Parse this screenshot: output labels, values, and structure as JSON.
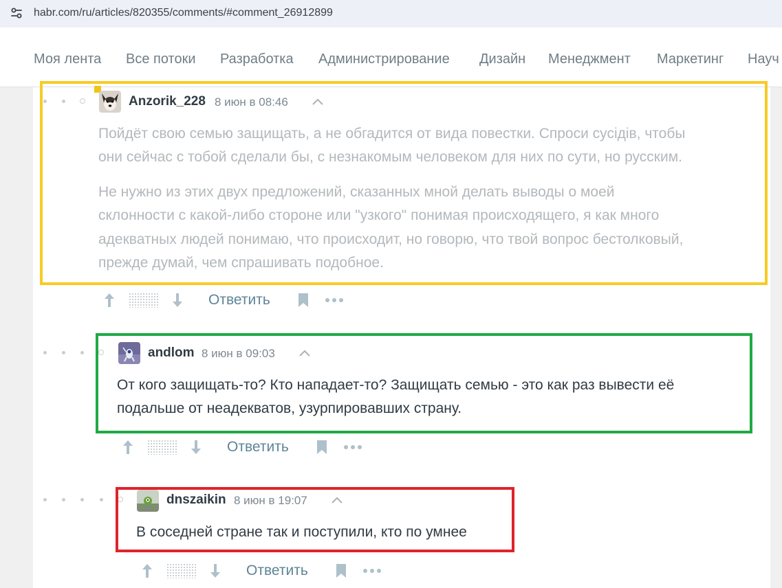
{
  "browser": {
    "url": "habr.com/ru/articles/820355/comments/#comment_26912899"
  },
  "nav": {
    "items": [
      "Моя лента",
      "Все потоки",
      "Разработка",
      "Администрирование",
      "Дизайн",
      "Менеджмент",
      "Маркетинг",
      "Науч"
    ]
  },
  "comments": [
    {
      "author": "Anzorik_228",
      "time": "8 июн в 08:46",
      "lines": [
        "Пойдёт свою семью защищать, а не обгадится от вида повестки. Спроси сусідів, чтобы",
        "они сейчас с тобой сделали бы, с незнакомым человеком для них по сути, но русским.",
        "Не нужно из этих двух предложений, сказанных мной делать выводы о моей",
        "склонности с какой-либо стороне или \"узкого\" понимая происходящего, я как много",
        "адекватных людей понимаю, что происходит, но говорю, что твой вопрос бестолковый,",
        "прежде думай, чем спрашивать подобное."
      ],
      "highlight_color": "#f7cb24"
    },
    {
      "author": "andlom",
      "time": "8 июн в 09:03",
      "lines": [
        "От кого защищать-то? Кто нападает-то? Защищать семью - это как раз вывести её",
        "подальше от неадекватов, узурпировавших страну."
      ],
      "highlight_color": "#1faa44"
    },
    {
      "author": "dnszaikin",
      "time": "8 июн в 19:07",
      "lines": [
        "В соседней стране так и поступили, кто по умнее"
      ],
      "highlight_color": "#e0232a"
    }
  ],
  "actions": {
    "reply_label": "Ответить",
    "upvote_icon": "arrow-up-icon",
    "downvote_icon": "arrow-down-icon",
    "bookmark_icon": "bookmark-icon",
    "more_icon": "more-dots-icon"
  },
  "colors": {
    "link": "#5e8496",
    "text_dark": "#303b44",
    "text_dim": "#b3b8bc"
  }
}
